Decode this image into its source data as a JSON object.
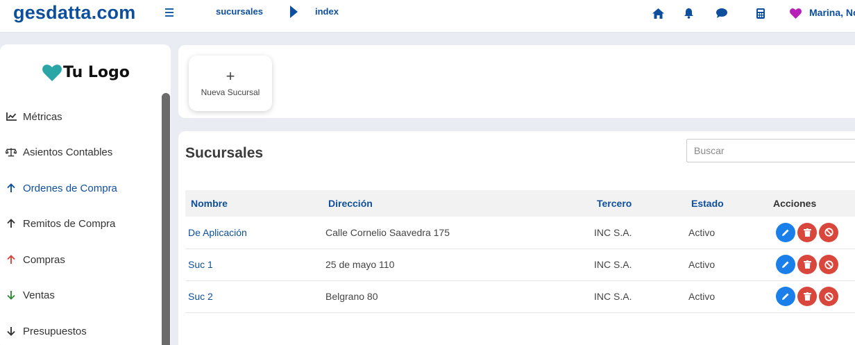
{
  "header": {
    "brand": "gesdatta.com",
    "breadcrumb": [
      "sucursales",
      "index"
    ],
    "user_name": "Marina, No",
    "icons": [
      "home-icon",
      "bell-icon",
      "chat-icon",
      "calculator-icon",
      "heart-icon"
    ],
    "colors": {
      "brand": "#0d4f9c",
      "heart": "#b620b8"
    }
  },
  "sidebar": {
    "logo_text": "Tu Logo",
    "logo_color": "#2aa6a6",
    "items": [
      {
        "label": "Métricas",
        "icon": "chart-line-icon"
      },
      {
        "label": "Asientos Contables",
        "icon": "scale-icon"
      },
      {
        "label": "Ordenes de Compra",
        "icon": "arrow-up-icon"
      },
      {
        "label": "Remitos de Compra",
        "icon": "arrow-up-icon"
      },
      {
        "label": "Compras",
        "icon": "arrow-up-red-icon"
      },
      {
        "label": "Ventas",
        "icon": "arrow-down-green-icon"
      },
      {
        "label": "Presupuestos",
        "icon": "arrow-down-icon"
      }
    ]
  },
  "toolbar": {
    "new_label": "Nueva Sucursal"
  },
  "main": {
    "title": "Sucursales",
    "search_placeholder": "Buscar",
    "columns": [
      "Nombre",
      "Dirección",
      "Tercero",
      "Estado",
      "Acciones"
    ],
    "rows": [
      {
        "nombre": "De Aplicación",
        "direccion": "Calle Cornelio Saavedra 175",
        "tercero": "INC S.A.",
        "estado": "Activo"
      },
      {
        "nombre": "Suc 1",
        "direccion": "25 de mayo 110",
        "tercero": "INC S.A.",
        "estado": "Activo"
      },
      {
        "nombre": "Suc 2",
        "direccion": "Belgrano 80",
        "tercero": "INC S.A.",
        "estado": "Activo"
      }
    ],
    "action_colors": {
      "edit": "#1a7fe8",
      "delete": "#d9463b",
      "disable": "#d9463b"
    }
  }
}
